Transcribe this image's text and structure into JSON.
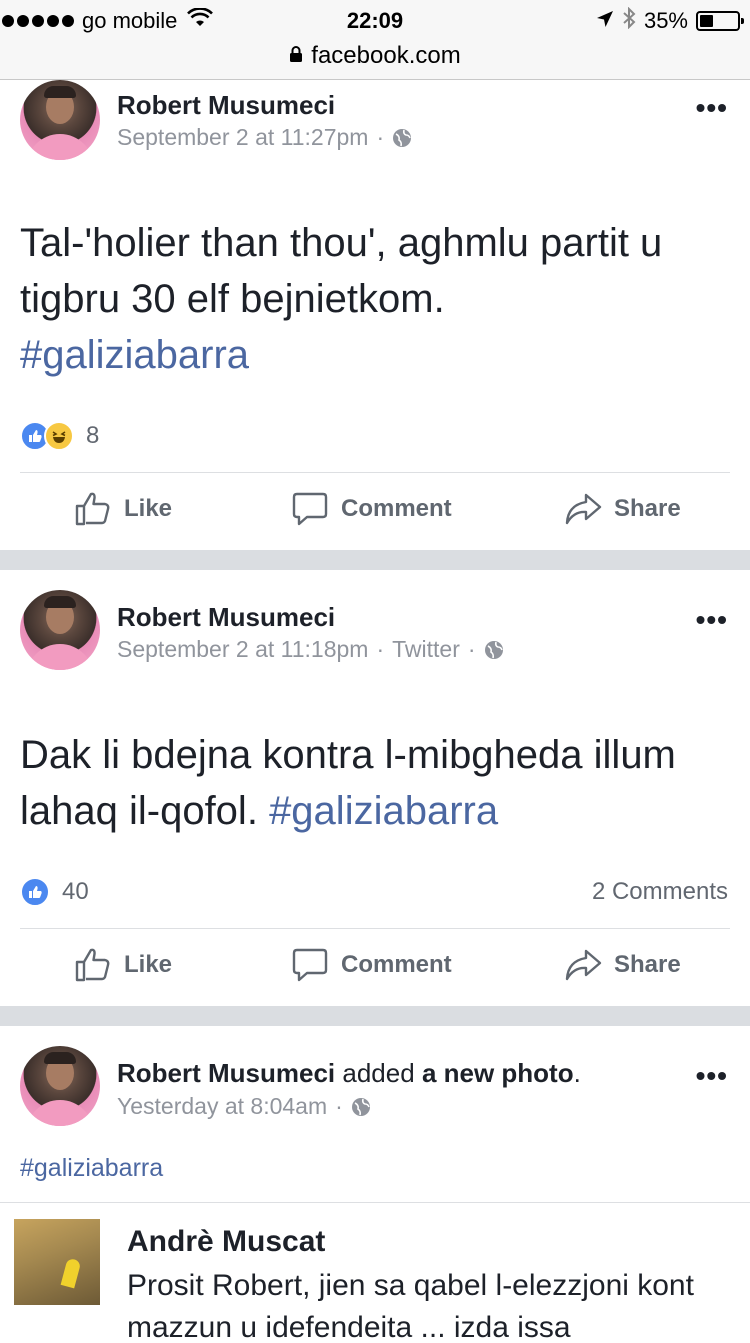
{
  "status_bar": {
    "carrier": "go mobile",
    "time": "22:09",
    "battery": "35%",
    "battery_level": 0.35
  },
  "url_bar": {
    "domain": "facebook.com"
  },
  "posts": [
    {
      "author": "Robert Musumeci",
      "timestamp": "September 2 at 11:27pm",
      "sep": "·",
      "text": "Tal-'holier than thou', aghmlu partit u tigbru 30 elf bejnietkom.",
      "hashtag": "#galiziabarra",
      "reactions": [
        "like",
        "haha"
      ],
      "reaction_count": "8",
      "actions": {
        "like": "Like",
        "comment": "Comment",
        "share": "Share"
      }
    },
    {
      "author": "Robert Musumeci",
      "timestamp": "September 2 at 11:18pm",
      "sep": "·",
      "source": "Twitter",
      "text": "Dak li bdejna kontra l-mibgheda illum lahaq il-qofol.",
      "hashtag": "#galiziabarra",
      "reactions": [
        "like"
      ],
      "reaction_count": "40",
      "comment_count": "2 Comments",
      "actions": {
        "like": "Like",
        "comment": "Comment",
        "share": "Share"
      }
    },
    {
      "author": "Robert Musumeci",
      "action_text": "added",
      "action_object": "a new photo",
      "period": ".",
      "timestamp": "Yesterday at 8:04am",
      "sep": "·",
      "hashtag": "#galiziabarra",
      "embedded": {
        "name": "Andrè Muscat",
        "text": "Prosit Robert, jien sa qabel l-elezzjoni kont mazzun u idefendeita ... izda issa"
      }
    }
  ],
  "icons": {
    "more": "more-options-icon",
    "globe": "globe-icon",
    "like": "thumbs-up-icon",
    "comment": "speech-bubble-icon",
    "share": "share-arrow-icon"
  },
  "colors": {
    "hashtag": "#4b67a1",
    "like_blue": "#4b88f0",
    "haha_yellow": "#f7c842",
    "divider": "#dadde1",
    "meta_gray": "#90949c"
  }
}
